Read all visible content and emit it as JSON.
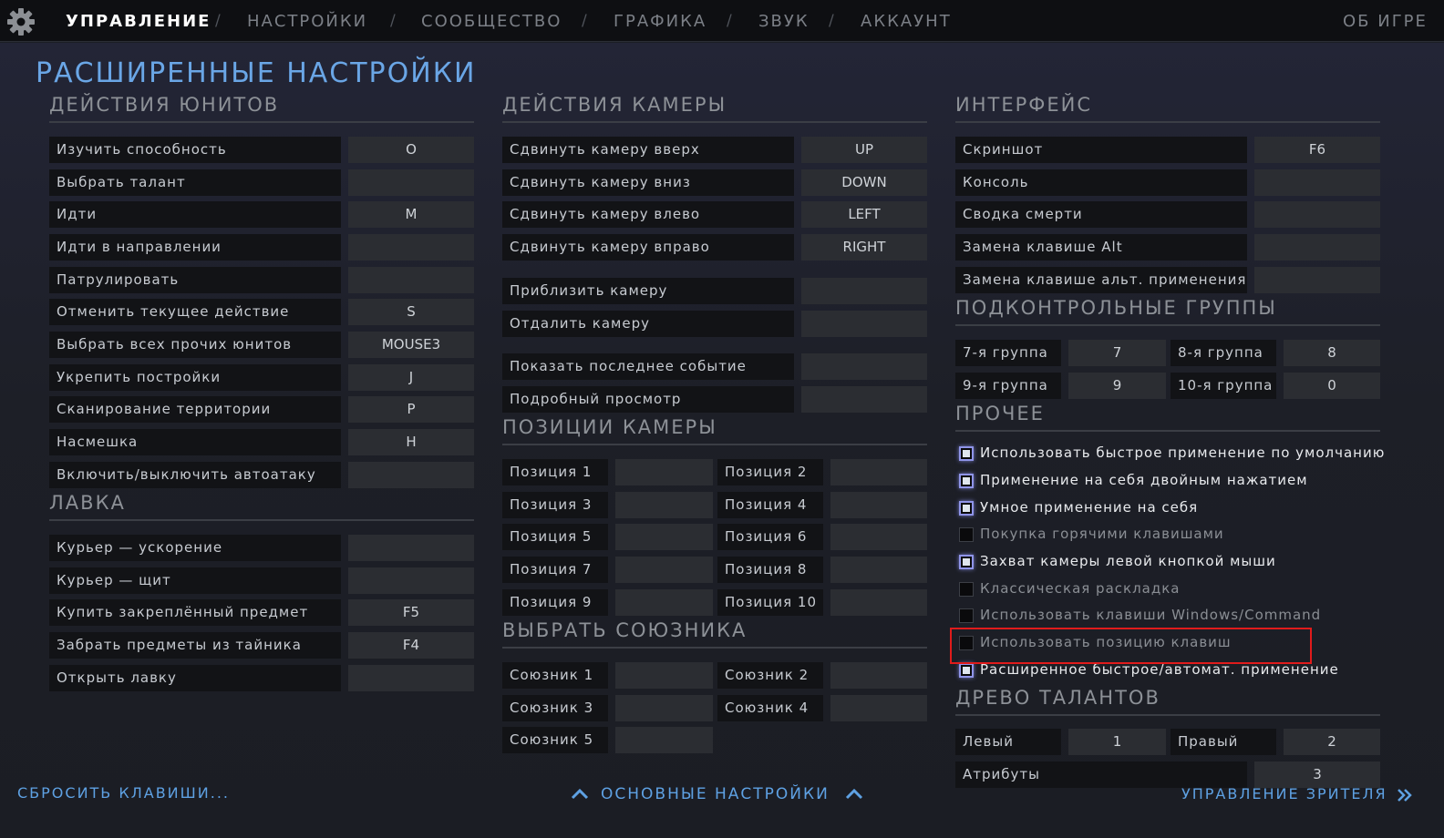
{
  "nav": {
    "items": [
      "УПРАВЛЕНИЕ",
      "НАСТРОЙКИ",
      "СООБЩЕСТВО",
      "ГРАФИКА",
      "ЗВУК",
      "АККАУНТ"
    ],
    "separator": "/",
    "about": "ОБ ИГРЕ"
  },
  "page_title": "РАСШИРЕННЫЕ НАСТРОЙКИ",
  "unit_actions": {
    "title": "ДЕЙСТВИЯ ЮНИТОВ",
    "rows": [
      {
        "label": "Изучить способность",
        "key": "O"
      },
      {
        "label": "Выбрать талант",
        "key": ""
      },
      {
        "label": "Идти",
        "key": "M"
      },
      {
        "label": "Идти в направлении",
        "key": ""
      },
      {
        "label": "Патрулировать",
        "key": ""
      },
      {
        "label": "Отменить текущее действие",
        "key": "S"
      },
      {
        "label": "Выбрать всех прочих юнитов",
        "key": "MOUSE3"
      },
      {
        "label": "Укрепить постройки",
        "key": "J"
      },
      {
        "label": "Сканирование территории",
        "key": "P"
      },
      {
        "label": "Насмешка",
        "key": "H"
      },
      {
        "label": "Включить/выключить автоатаку",
        "key": ""
      }
    ]
  },
  "shop": {
    "title": "ЛАВКА",
    "rows": [
      {
        "label": "Курьер — ускорение",
        "key": ""
      },
      {
        "label": "Курьер — щит",
        "key": ""
      },
      {
        "label": "Купить закреплённый предмет",
        "key": "F5"
      },
      {
        "label": "Забрать предметы из тайника",
        "key": "F4"
      },
      {
        "label": "Открыть лавку",
        "key": ""
      }
    ]
  },
  "camera_actions": {
    "title": "ДЕЙСТВИЯ КАМЕРЫ",
    "rows": [
      {
        "label": "Сдвинуть камеру вверх",
        "key": "UP"
      },
      {
        "label": "Сдвинуть камеру вниз",
        "key": "DOWN"
      },
      {
        "label": "Сдвинуть камеру влево",
        "key": "LEFT"
      },
      {
        "label": "Сдвинуть камеру вправо",
        "key": "RIGHT"
      },
      {
        "label": "Приблизить камеру",
        "key": ""
      },
      {
        "label": "Отдалить камеру",
        "key": ""
      },
      {
        "label": "Показать последнее событие",
        "key": ""
      },
      {
        "label": "Подробный просмотр",
        "key": ""
      }
    ]
  },
  "camera_positions": {
    "title": "ПОЗИЦИИ КАМЕРЫ",
    "rows": [
      {
        "label": "Позиция 1",
        "key": ""
      },
      {
        "label": "Позиция 2",
        "key": ""
      },
      {
        "label": "Позиция 3",
        "key": ""
      },
      {
        "label": "Позиция 4",
        "key": ""
      },
      {
        "label": "Позиция 5",
        "key": ""
      },
      {
        "label": "Позиция 6",
        "key": ""
      },
      {
        "label": "Позиция 7",
        "key": ""
      },
      {
        "label": "Позиция 8",
        "key": ""
      },
      {
        "label": "Позиция 9",
        "key": ""
      },
      {
        "label": "Позиция 10",
        "key": ""
      }
    ]
  },
  "select_ally": {
    "title": "ВЫБРАТЬ СОЮЗНИКА",
    "rows": [
      {
        "label": "Союзник 1",
        "key": ""
      },
      {
        "label": "Союзник 2",
        "key": ""
      },
      {
        "label": "Союзник 3",
        "key": ""
      },
      {
        "label": "Союзник 4",
        "key": ""
      },
      {
        "label": "Союзник 5",
        "key": ""
      }
    ]
  },
  "interface": {
    "title": "ИНТЕРФЕЙС",
    "rows": [
      {
        "label": "Скриншот",
        "key": "F6"
      },
      {
        "label": "Консоль",
        "key": ""
      },
      {
        "label": "Сводка смерти",
        "key": ""
      },
      {
        "label": "Замена клавише Alt",
        "key": ""
      },
      {
        "label": "Замена клавише альт. применения",
        "key": ""
      }
    ]
  },
  "control_groups": {
    "title": "ПОДКОНТРОЛЬНЫЕ ГРУППЫ",
    "rows": [
      {
        "label": "7-я группа",
        "key": "7"
      },
      {
        "label": "8-я группа",
        "key": "8"
      },
      {
        "label": "9-я группа",
        "key": "9"
      },
      {
        "label": "10-я группа",
        "key": "0"
      }
    ]
  },
  "misc": {
    "title": "ПРОЧЕЕ",
    "options": [
      {
        "label": "Использовать быстрое применение по умолчанию",
        "checked": true
      },
      {
        "label": "Применение на себя двойным нажатием",
        "checked": true
      },
      {
        "label": "Умное применение на себя",
        "checked": true
      },
      {
        "label": "Покупка горячими клавишами",
        "checked": false
      },
      {
        "label": "Захват камеры левой кнопкой мыши",
        "checked": true
      },
      {
        "label": "Классическая раскладка",
        "checked": false
      },
      {
        "label": "Использовать клавиши Windows/Command",
        "checked": false
      },
      {
        "label": "Использовать позицию клавиш",
        "checked": false
      },
      {
        "label": "Расширенное быстрое/автомат. применение",
        "checked": true
      }
    ]
  },
  "talent_tree": {
    "title": "ДРЕВО ТАЛАНТОВ",
    "rows": [
      {
        "label": "Левый",
        "key": "1"
      },
      {
        "label": "Правый",
        "key": "2"
      },
      {
        "label": "Атрибуты",
        "key": "3"
      }
    ]
  },
  "footer": {
    "reset": "СБРОСИТЬ КЛАВИШИ...",
    "basic": "ОСНОВНЫЕ НАСТРОЙКИ",
    "spectator": "УПРАВЛЕНИЕ ЗРИТЕЛЯ"
  },
  "colors": {
    "accent": "#6aa6e6",
    "highlight": "#e01b1b",
    "checkbox_glow": "#8f94e8"
  }
}
